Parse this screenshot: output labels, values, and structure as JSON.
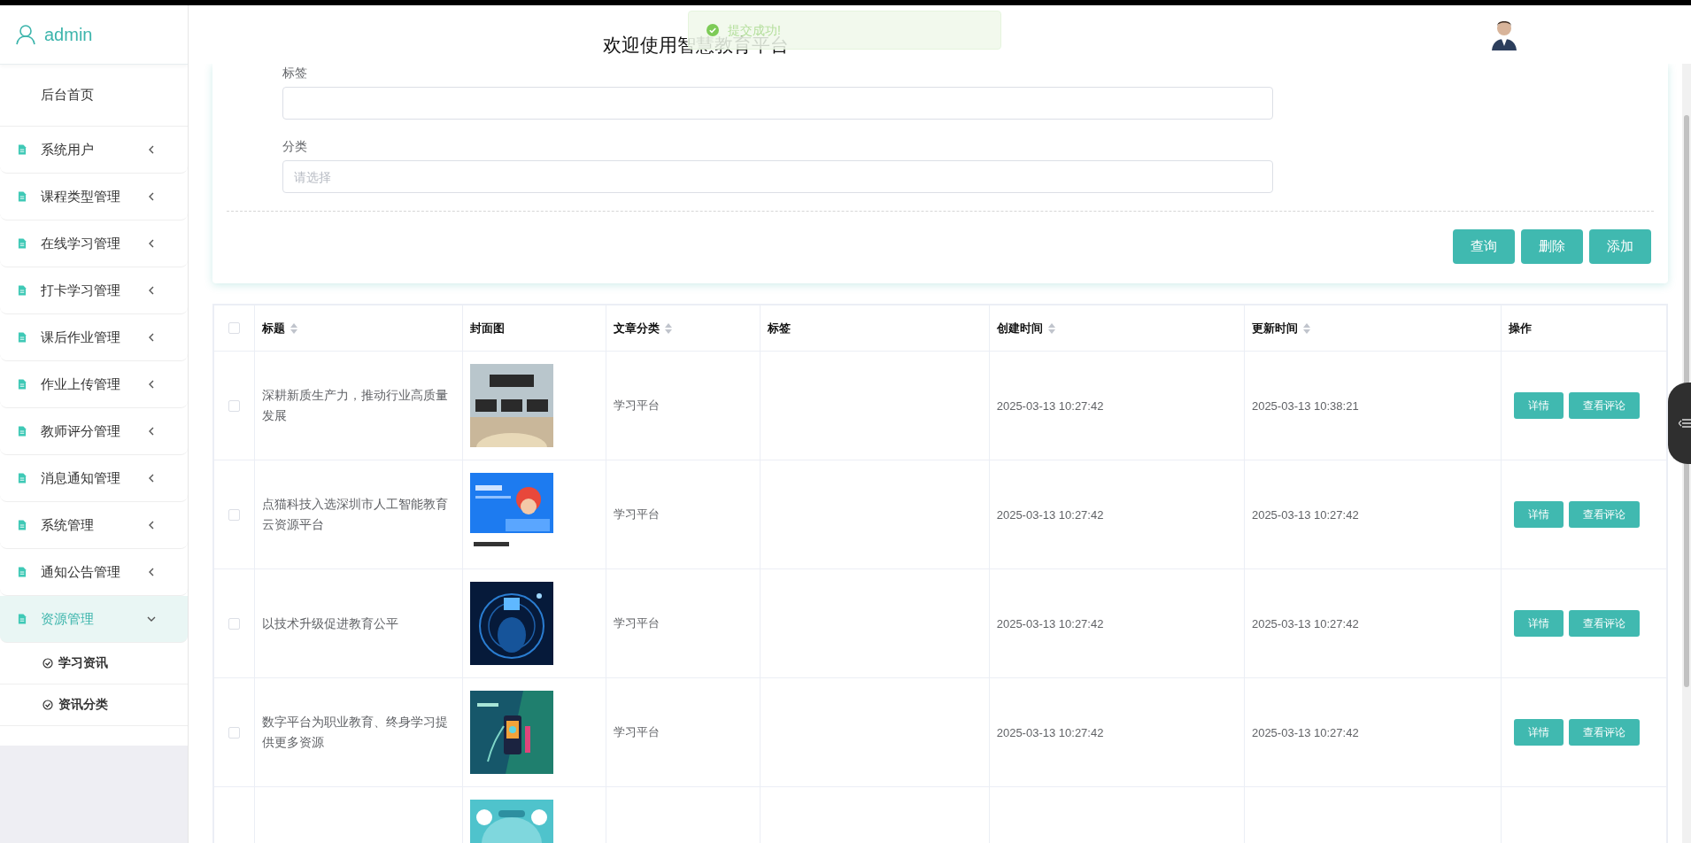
{
  "sidebar": {
    "user": "admin",
    "items": [
      {
        "kind": "home",
        "label": "后台首页"
      },
      {
        "kind": "menu",
        "label": "系统用户",
        "expanded": false,
        "selected": false
      },
      {
        "kind": "menu",
        "label": "课程类型管理",
        "expanded": false,
        "selected": false
      },
      {
        "kind": "menu",
        "label": "在线学习管理",
        "expanded": false,
        "selected": false
      },
      {
        "kind": "menu",
        "label": "打卡学习管理",
        "expanded": false,
        "selected": false
      },
      {
        "kind": "menu",
        "label": "课后作业管理",
        "expanded": false,
        "selected": false
      },
      {
        "kind": "menu",
        "label": "作业上传管理",
        "expanded": false,
        "selected": false
      },
      {
        "kind": "menu",
        "label": "教师评分管理",
        "expanded": false,
        "selected": false
      },
      {
        "kind": "menu",
        "label": "消息通知管理",
        "expanded": false,
        "selected": false
      },
      {
        "kind": "menu",
        "label": "系统管理",
        "expanded": false,
        "selected": false
      },
      {
        "kind": "menu",
        "label": "通知公告管理",
        "expanded": false,
        "selected": false
      },
      {
        "kind": "menu",
        "label": "资源管理",
        "expanded": true,
        "selected": true,
        "children": [
          {
            "label": "学习资讯"
          },
          {
            "label": "资讯分类"
          }
        ]
      }
    ]
  },
  "header": {
    "title": "欢迎使用智慧教育平台"
  },
  "toast": {
    "message": "提交成功!"
  },
  "search_form": {
    "fields": [
      {
        "label": "标签"
      },
      {
        "label": "分类",
        "placeholder": "请选择"
      }
    ],
    "buttons": [
      "查询",
      "删除",
      "添加"
    ]
  },
  "table": {
    "select_all": {
      "checked": false
    },
    "columns": [
      {
        "label": "标题",
        "sortable": true
      },
      {
        "label": "封面图",
        "sortable": false
      },
      {
        "label": "文章分类",
        "sortable": true
      },
      {
        "label": "标签",
        "sortable": false
      },
      {
        "label": "创建时间",
        "sortable": true
      },
      {
        "label": "更新时间",
        "sortable": true
      },
      {
        "label": "操作",
        "sortable": false
      }
    ],
    "rows": [
      {
        "checked": false,
        "title": "深耕新质生产力，推动行业高质量发展",
        "cover": {
          "kind": "picture"
        },
        "category": "学习平台",
        "created": "2025-03-13 10:27:42",
        "updated": "2025-03-13 10:38:21",
        "actions": [
          "详情",
          "查看评论"
        ]
      },
      {
        "checked": false,
        "title": "点猫科技入选深圳市人工智能教育云资源平台",
        "cover": {
          "kind": "picture"
        },
        "category": "学习平台",
        "created": "2025-03-13 10:27:42",
        "updated": "2025-03-13 10:27:42",
        "actions": [
          "详情",
          "查看评论"
        ]
      },
      {
        "checked": false,
        "title": "以技术升级促进教育公平",
        "cover": {
          "kind": "picture"
        },
        "category": "学习平台",
        "created": "2025-03-13 10:27:42",
        "updated": "2025-03-13 10:27:42",
        "actions": [
          "详情",
          "查看评论"
        ]
      },
      {
        "checked": false,
        "title": "数字平台为职业教育、终身学习提供更多资源",
        "cover": {
          "kind": "picture"
        },
        "category": "学习平台",
        "created": "2025-03-13 10:27:42",
        "updated": "2025-03-13 10:27:42",
        "actions": [
          "详情",
          "查看评论"
        ]
      },
      {
        "cover": {
          "kind": "picture"
        }
      }
    ]
  }
}
